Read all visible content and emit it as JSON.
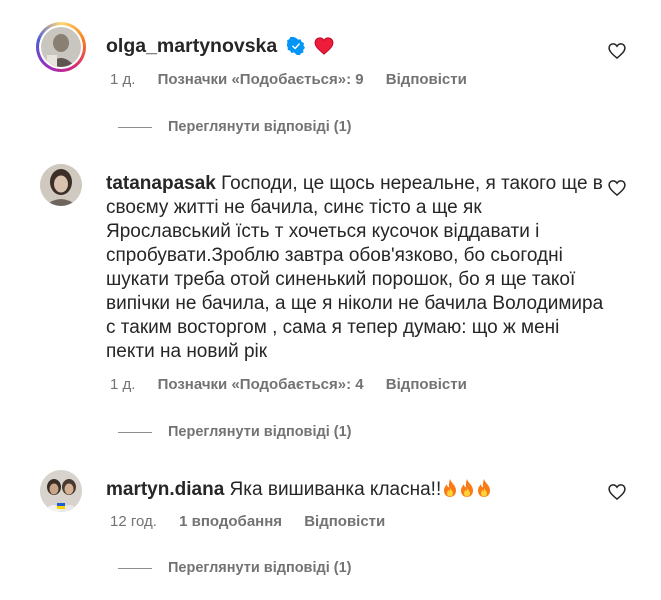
{
  "comments": [
    {
      "username": "olga_martynovska",
      "verified": true,
      "emoji_after_name": "heart",
      "text": "",
      "time": "1 д.",
      "likes": "Позначки «Подобається»: 9",
      "reply": "Відповісти",
      "view_replies": "Переглянути відповіді (1)"
    },
    {
      "username": "tatanapasak",
      "text": "Господи, це щось нереальне, я такого ще в своєму житті не бачила, синє тісто а ще як Ярославський їсть т хочеться кусочок віддавати і спробувати.Зроблю завтра обов'язково, бо сьогодні шукати треба отой синенький порошок, бо я ще такої випічки не бачила, а ще я ніколи не бачила Володимира с таким восторгом , сама я тепер думаю: що ж мені пекти на новий рік",
      "time": "1 д.",
      "likes": "Позначки «Подобається»: 4",
      "reply": "Відповісти",
      "view_replies": "Переглянути відповіді (1)"
    },
    {
      "username": "martyn.diana",
      "text": "Яка вишиванка класна!!",
      "emoji_after_text": [
        "fire",
        "fire",
        "fire"
      ],
      "time": "12 год.",
      "likes": "1 вподобання",
      "reply": "Відповісти",
      "view_replies": "Переглянути відповіді (1)"
    }
  ],
  "colors": {
    "text": "#262626",
    "secondary": "#737373",
    "verified": "#0095f6",
    "heart": "#ed4956"
  }
}
